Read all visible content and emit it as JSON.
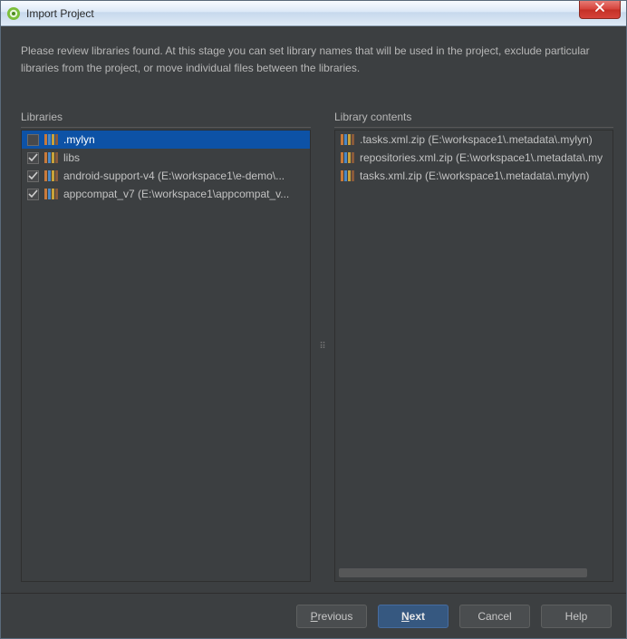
{
  "window": {
    "title": "Import Project"
  },
  "description": "Please review libraries found. At this stage you can set library names that will be used in the project, exclude particular libraries from the project, or move individual files between the libraries.",
  "panes": {
    "libraries_label": "Libraries",
    "contents_label": "Library contents"
  },
  "libraries": [
    {
      "checked": false,
      "selected": true,
      "label": ".mylyn"
    },
    {
      "checked": true,
      "selected": false,
      "label": "libs"
    },
    {
      "checked": true,
      "selected": false,
      "label": "android-support-v4 (E:\\workspace1\\e-demo\\..."
    },
    {
      "checked": true,
      "selected": false,
      "label": "appcompat_v7 (E:\\workspace1\\appcompat_v..."
    }
  ],
  "contents": [
    {
      "label": ".tasks.xml.zip (E:\\workspace1\\.metadata\\.mylyn)"
    },
    {
      "label": "repositories.xml.zip (E:\\workspace1\\.metadata\\.my"
    },
    {
      "label": "tasks.xml.zip (E:\\workspace1\\.metadata\\.mylyn)"
    }
  ],
  "buttons": {
    "previous": "Previous",
    "next": "Next",
    "cancel": "Cancel",
    "help": "Help"
  }
}
